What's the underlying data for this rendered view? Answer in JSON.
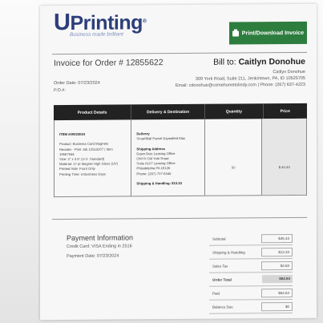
{
  "brand": {
    "name": "Printing",
    "initial": "U",
    "registered": "®",
    "tagline": "Business made brilliant"
  },
  "header": {
    "button_label": "Print/Download Invoice"
  },
  "invoice": {
    "title_prefix": "Invoice for Order # ",
    "order_number": "12855622",
    "order_date": "Order Date: 07/23/2024",
    "po": "P.O.#:"
  },
  "billing": {
    "label": "Bill to: ",
    "name": "Caitlyn Donohue",
    "contact_name": "Caitlyn Donohue",
    "address": "309 York Road, Suite 211, Jenkintown, PA, ID 10525705",
    "contact": "Email: cdonohue@comehometolindy.com | Phone: (267) 637-4223"
  },
  "table": {
    "headers": [
      "Product Details",
      "Delivery & Destination",
      "Quantity",
      "Price"
    ],
    "product": {
      "item": "ITEM #00023024",
      "lines": [
        "Product: Business Card Magnets",
        "Reorder - Print Job 12515207 | Item 19587944",
        "Size: 2\" x 3.5\" (U.S. Standard)",
        "Material: 17 pt Magnet High Gloss (UV)",
        "Printed Side: Front Only",
        "Printing Time: 4 Business Days"
      ]
    },
    "delivery": {
      "heading": "Delivery",
      "method": "SmartMail Parcel Expedited Max",
      "ship_heading": "Shipping Address",
      "ship_lines": [
        "Dawn Butz Leasing Office",
        "ONYX Old York Road",
        "Suite A107 Leasing Office",
        "Philadelphia PA 19126",
        "Phone: (267) 707-6346"
      ],
      "handling": "Shipping & Handling: $13.33"
    },
    "quantity": "50",
    "price": "$ 45.43"
  },
  "payment": {
    "title": "Payment Information",
    "card": "Credit Card: VISA Ending in 2516",
    "date": "Payment Date: 07/23/2024"
  },
  "totals": [
    {
      "label": "Subtotal",
      "value": "$45.43"
    },
    {
      "label": "Shipping & Handling",
      "value": "$13.33"
    },
    {
      "label": "Sales Tax",
      "value": "$3.68"
    },
    {
      "label": "Order Total",
      "value": "$64.64"
    },
    {
      "label": "Paid",
      "value": "$64.64"
    },
    {
      "label": "Balance Due",
      "value": "$0"
    }
  ]
}
